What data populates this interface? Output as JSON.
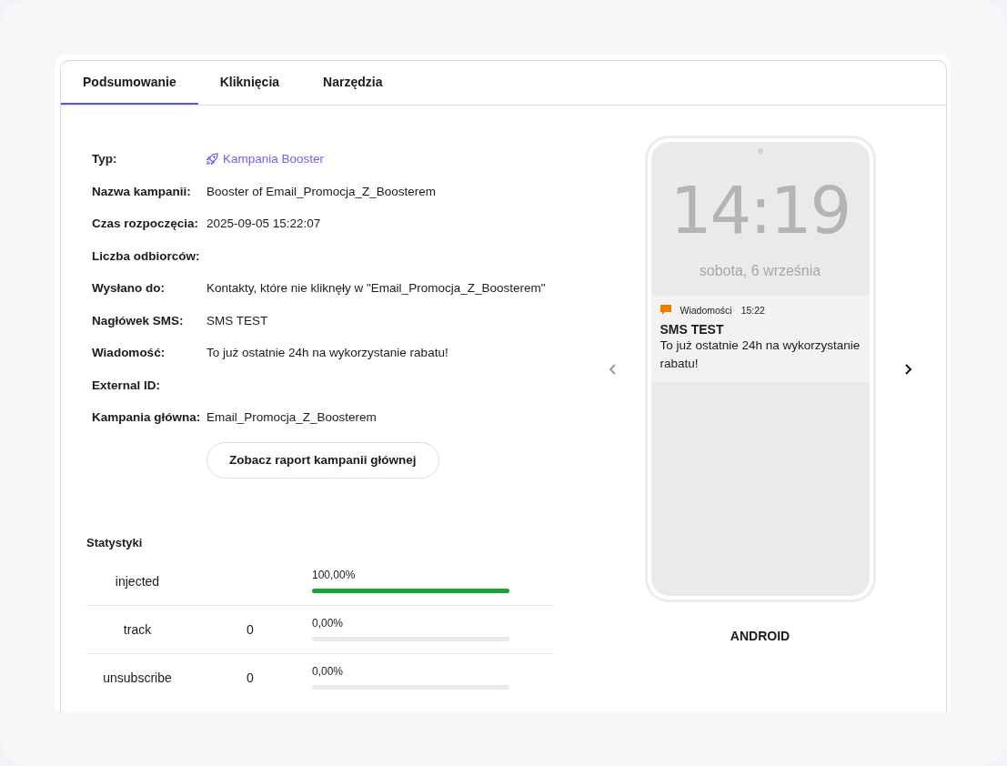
{
  "tabs": [
    {
      "label": "Podsumowanie",
      "selected": true
    },
    {
      "label": "Kliknięcia",
      "selected": false
    },
    {
      "label": "Narzędzia",
      "selected": false
    }
  ],
  "details": [
    {
      "label": "Typ:",
      "value": "Kampania Booster",
      "kind": "link"
    },
    {
      "label": "Nazwa kampanii:",
      "value": "Booster of Email_Promocja_Z_Boosterem",
      "kind": "text"
    },
    {
      "label": "Czas rozpoczęcia:",
      "value": "2025-09-05 15:22:07",
      "kind": "text"
    },
    {
      "label": "Liczba odbiorców:"
    },
    {
      "label": "Wysłano do:",
      "value": "Kontakty, które nie kliknęły w \"Email_Promocja_Z_Boosterem\"",
      "kind": "text"
    },
    {
      "label": "Nagłówek SMS:",
      "value": "SMS TEST",
      "kind": "text"
    },
    {
      "label": "Wiadomość:",
      "value": "To już ostatnie 24h na wykorzystanie rabatu!",
      "kind": "text"
    },
    {
      "label": "External ID:"
    },
    {
      "label": "Kampania główna:",
      "value": "Email_Promocja_Z_Boosterem",
      "kind": "text"
    }
  ],
  "report_button": "Zobacz raport kampanii głównej",
  "statistics": {
    "title": "Statystyki",
    "rows": [
      {
        "name": "injected",
        "percent": "100,00%",
        "level": 1
      },
      {
        "name": "track",
        "count": "0",
        "percent": "0,00%",
        "level": 0
      },
      {
        "name": "unsubscribe",
        "count": "0",
        "percent": "0,00%",
        "level": 0
      }
    ]
  },
  "preview": {
    "clock": "14:19",
    "date": "sobota, 6 września",
    "notification": {
      "app": "Wiadomości",
      "time": "15:22",
      "title": "SMS TEST",
      "body": "To już ostatnie 24h na wykorzystanie rabatu!"
    },
    "platform": "ANDROID"
  }
}
